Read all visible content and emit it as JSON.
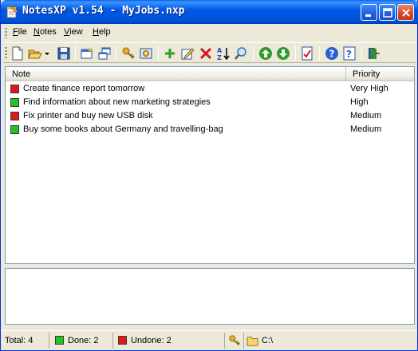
{
  "window": {
    "title": "NotesXP v1.54 - MyJobs.nxp"
  },
  "menu": {
    "items": [
      {
        "label": "File"
      },
      {
        "label": "Notes"
      },
      {
        "label": "View"
      },
      {
        "label": "Help"
      }
    ]
  },
  "toolbar": {
    "buttons": [
      {
        "icon": "new-file-icon"
      },
      {
        "icon": "open-folder-icon"
      },
      {
        "icon": "dropdown-arrow-icon"
      },
      {
        "icon": "save-icon"
      },
      {
        "icon": "new-window-icon"
      },
      {
        "icon": "windows-icon"
      },
      {
        "icon": "key-icon"
      },
      {
        "icon": "settings-icon"
      },
      {
        "icon": "add-icon"
      },
      {
        "icon": "edit-icon"
      },
      {
        "icon": "delete-icon"
      },
      {
        "icon": "sort-az-icon"
      },
      {
        "icon": "find-icon"
      },
      {
        "icon": "move-up-icon"
      },
      {
        "icon": "move-down-icon"
      },
      {
        "icon": "mark-done-icon"
      },
      {
        "icon": "help-icon"
      },
      {
        "icon": "about-icon"
      },
      {
        "icon": "exit-icon"
      }
    ]
  },
  "list": {
    "columns": {
      "note": "Note",
      "priority": "Priority"
    },
    "rows": [
      {
        "note": "Create finance report tomorrow",
        "priority": "Very High",
        "status": "undone"
      },
      {
        "note": "Find information about new marketing strategies",
        "priority": "High",
        "status": "done"
      },
      {
        "note": "Fix printer and buy new USB disk",
        "priority": "Medium",
        "status": "undone"
      },
      {
        "note": "Buy some books about Germany and travelling-bag",
        "priority": "Medium",
        "status": "done"
      }
    ]
  },
  "colors": {
    "done": "#22c322",
    "undone": "#e01818"
  },
  "status": {
    "total": "Total: 4",
    "done": "Done: 2",
    "undone": "Undone: 2",
    "path": "C:\\"
  }
}
